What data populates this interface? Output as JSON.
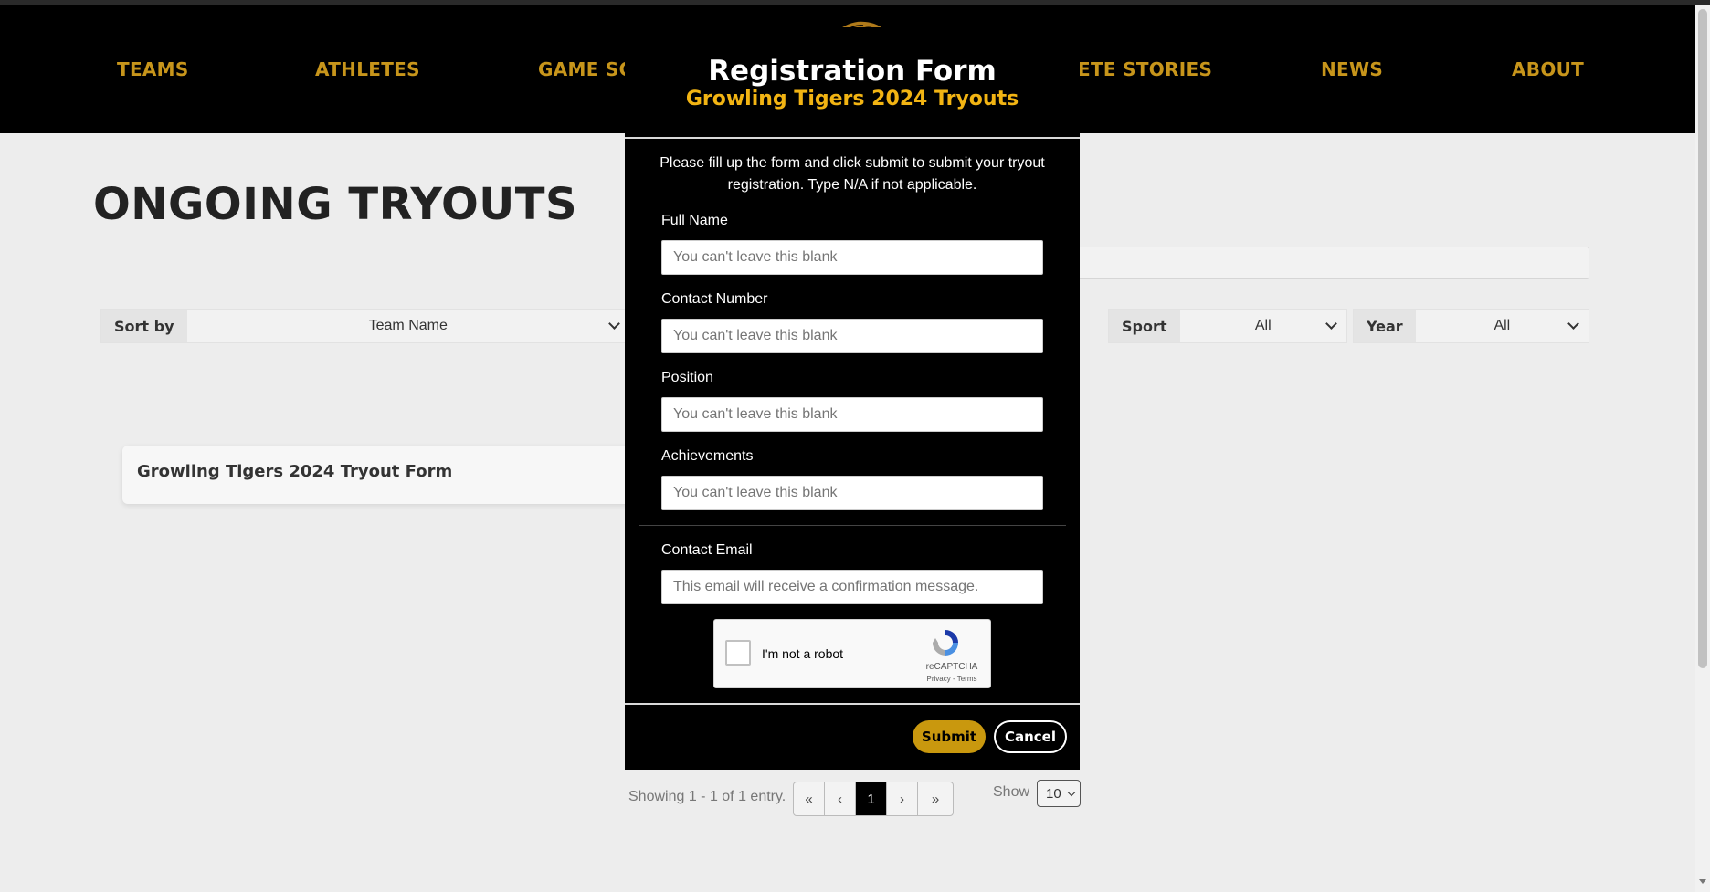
{
  "nav": {
    "items": [
      {
        "label": "TEAMS"
      },
      {
        "label": "ATHLETES"
      },
      {
        "label": "GAME SCH"
      },
      {
        "label": "ETE STORIES"
      },
      {
        "label": "NEWS"
      },
      {
        "label": "ABOUT"
      }
    ]
  },
  "page": {
    "title": "ONGOING TRYOUTS"
  },
  "filters": {
    "sort": {
      "label": "Sort by",
      "value": "Team Name"
    },
    "sport": {
      "label": "Sport",
      "value": "All"
    },
    "year": {
      "label": "Year",
      "value": "All"
    }
  },
  "tryouts": [
    {
      "title": "Growling Tigers 2024 Tryout Form"
    }
  ],
  "pagination": {
    "info": "Showing 1 - 1 of 1 entry.",
    "current_page": "1",
    "first_icon": "«",
    "prev_icon": "‹",
    "next_icon": "›",
    "last_icon": "»",
    "show_label": "Show",
    "show_value": "10"
  },
  "modal": {
    "title": "Registration Form",
    "subtitle": "Growling Tigers 2024 Tryouts",
    "intro": "Please fill up the form and click submit to submit your tryout registration. Type N/A if not applicable.",
    "fields": [
      {
        "label": "Full Name",
        "placeholder": "You can't leave this blank",
        "value": ""
      },
      {
        "label": "Contact Number",
        "placeholder": "You can't leave this blank",
        "value": ""
      },
      {
        "label": "Position",
        "placeholder": "You can't leave this blank",
        "value": ""
      },
      {
        "label": "Achievements",
        "placeholder": "You can't leave this blank",
        "value": ""
      }
    ],
    "email": {
      "label": "Contact Email",
      "placeholder": "This email will receive a confirmation message.",
      "value": ""
    },
    "captcha": {
      "text": "I'm not a robot",
      "brand": "reCAPTCHA",
      "links": "Privacy - Terms"
    },
    "submit_label": "Submit",
    "cancel_label": "Cancel"
  },
  "colors": {
    "nav_text": "#c7951b",
    "modal_accent": "#f2b413",
    "submit_bg": "#c9980e"
  }
}
